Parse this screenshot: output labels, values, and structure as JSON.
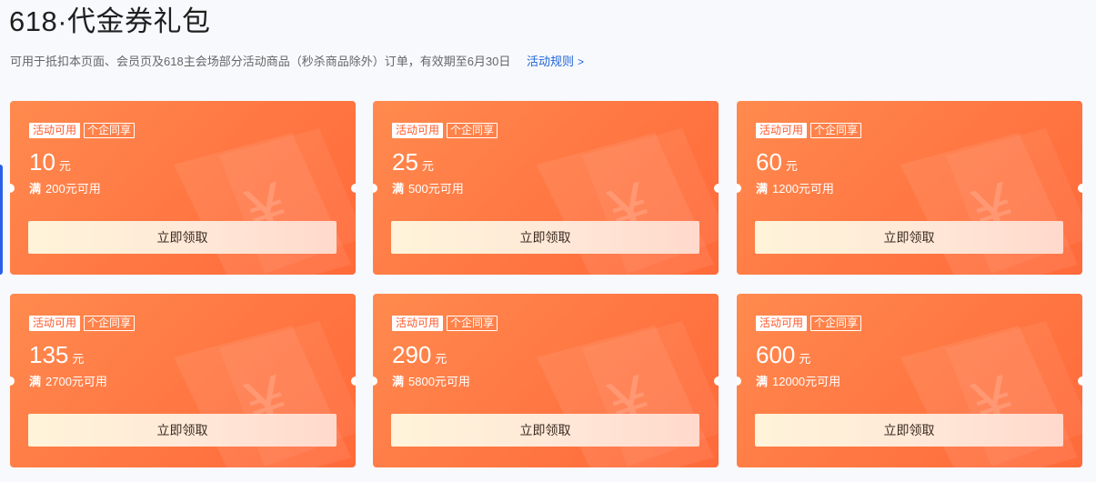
{
  "header": {
    "title": "618·代金券礼包",
    "description": "可用于抵扣本页面、会员页及618主会场部分活动商品（秒杀商品除外）订单，有效期至6月30日",
    "rules_link": "活动规则",
    "rules_arrow": ">"
  },
  "colors": {
    "card_gradient_start": "#ff8a4e",
    "card_gradient_end": "#ff6a3a",
    "button_gradient_start": "#fff4d9",
    "button_gradient_end": "#ffd9cc",
    "link": "#1e63d6"
  },
  "coupons": [
    {
      "tag_activity": "活动可用",
      "tag_shared": "个企同享",
      "amount": "10",
      "unit": "元",
      "threshold_prefix": "满",
      "threshold": "200元可用",
      "button": "立即领取"
    },
    {
      "tag_activity": "活动可用",
      "tag_shared": "个企同享",
      "amount": "25",
      "unit": "元",
      "threshold_prefix": "满",
      "threshold": "500元可用",
      "button": "立即领取"
    },
    {
      "tag_activity": "活动可用",
      "tag_shared": "个企同享",
      "amount": "60",
      "unit": "元",
      "threshold_prefix": "满",
      "threshold": "1200元可用",
      "button": "立即领取"
    },
    {
      "tag_activity": "活动可用",
      "tag_shared": "个企同享",
      "amount": "135",
      "unit": "元",
      "threshold_prefix": "满",
      "threshold": "2700元可用",
      "button": "立即领取"
    },
    {
      "tag_activity": "活动可用",
      "tag_shared": "个企同享",
      "amount": "290",
      "unit": "元",
      "threshold_prefix": "满",
      "threshold": "5800元可用",
      "button": "立即领取"
    },
    {
      "tag_activity": "活动可用",
      "tag_shared": "个企同享",
      "amount": "600",
      "unit": "元",
      "threshold_prefix": "满",
      "threshold": "12000元可用",
      "button": "立即领取"
    }
  ]
}
